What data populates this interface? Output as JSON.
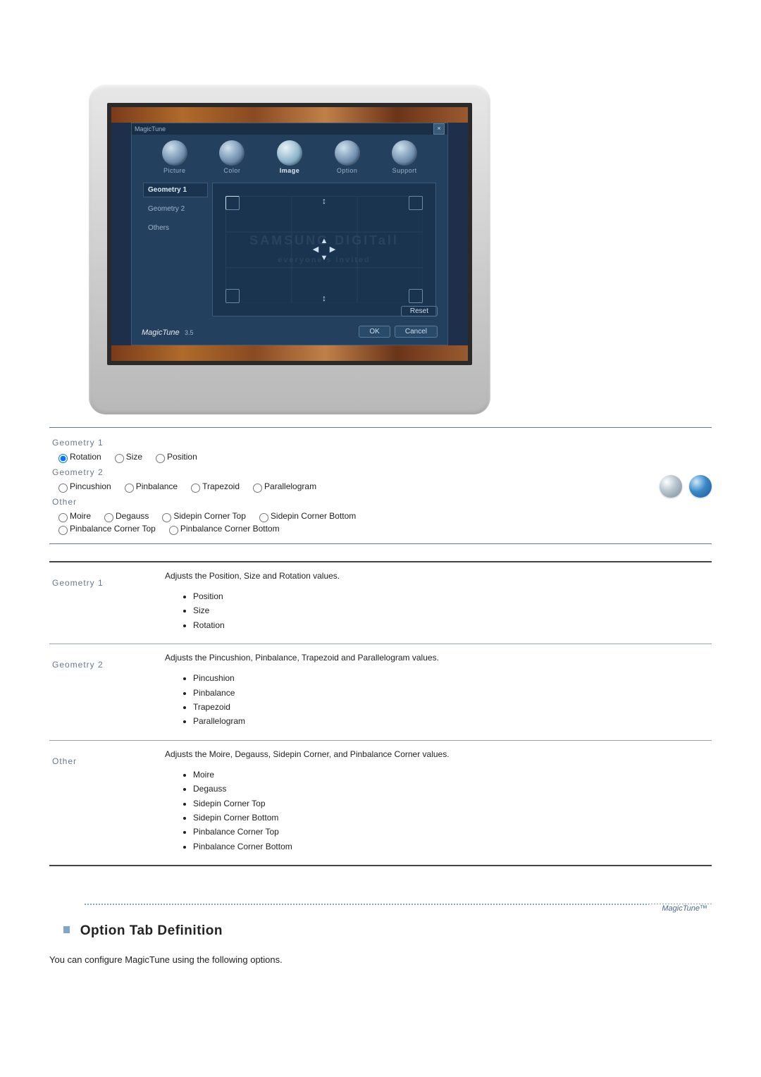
{
  "app": {
    "title": "MagicTune",
    "version": "3.5",
    "logo_text": "MagicTune",
    "tabs": [
      {
        "label": "Picture",
        "active": false
      },
      {
        "label": "Color",
        "active": false
      },
      {
        "label": "Image",
        "active": true
      },
      {
        "label": "Option",
        "active": false
      },
      {
        "label": "Support",
        "active": false
      }
    ],
    "side_tabs": [
      {
        "label": "Geometry 1",
        "active": true
      },
      {
        "label": "Geometry 2",
        "active": false
      },
      {
        "label": "Others",
        "active": false
      }
    ],
    "buttons": {
      "reset": "Reset",
      "ok": "OK",
      "cancel": "Cancel"
    },
    "watermark": {
      "line1": "SAMSUNG DIGITall",
      "line2": "everyone's invited"
    }
  },
  "radio_groups": [
    {
      "title": "Geometry 1",
      "lines": [
        [
          {
            "label": "Rotation",
            "checked": true
          },
          {
            "label": "Size",
            "checked": false
          },
          {
            "label": "Position",
            "checked": false
          }
        ]
      ]
    },
    {
      "title": "Geometry 2",
      "lines": [
        [
          {
            "label": "Pincushion",
            "checked": false
          },
          {
            "label": "Pinbalance",
            "checked": false
          },
          {
            "label": "Trapezoid",
            "checked": false
          },
          {
            "label": "Parallelogram",
            "checked": false
          }
        ]
      ]
    },
    {
      "title": "Other",
      "lines": [
        [
          {
            "label": "Moire",
            "checked": false
          },
          {
            "label": "Degauss",
            "checked": false
          },
          {
            "label": "Sidepin Corner Top",
            "checked": false
          },
          {
            "label": "Sidepin Corner Bottom",
            "checked": false
          }
        ],
        [
          {
            "label": "Pinbalance Corner Top",
            "checked": false
          },
          {
            "label": "Pinbalance Corner Bottom",
            "checked": false
          }
        ]
      ]
    }
  ],
  "desc_rows": [
    {
      "label": "Geometry 1",
      "intro": "Adjusts the Position, Size and Rotation values.",
      "items": [
        "Position",
        "Size",
        "Rotation"
      ]
    },
    {
      "label": "Geometry 2",
      "intro": "Adjusts the Pincushion, Pinbalance, Trapezoid and Parallelogram values.",
      "items": [
        "Pincushion",
        "Pinbalance",
        "Trapezoid",
        "Parallelogram"
      ]
    },
    {
      "label": "Other",
      "intro": "Adjusts the Moire, Degauss, Sidepin Corner, and Pinbalance Corner values.",
      "items": [
        "Moire",
        "Degauss",
        "Sidepin Corner Top",
        "Sidepin Corner Bottom",
        "Pinbalance Corner Top",
        "Pinbalance Corner Bottom"
      ]
    }
  ],
  "footer_logo": "MagicTune™",
  "section": {
    "title": "Option Tab Definition",
    "sub": "You can configure MagicTune using the following options."
  }
}
